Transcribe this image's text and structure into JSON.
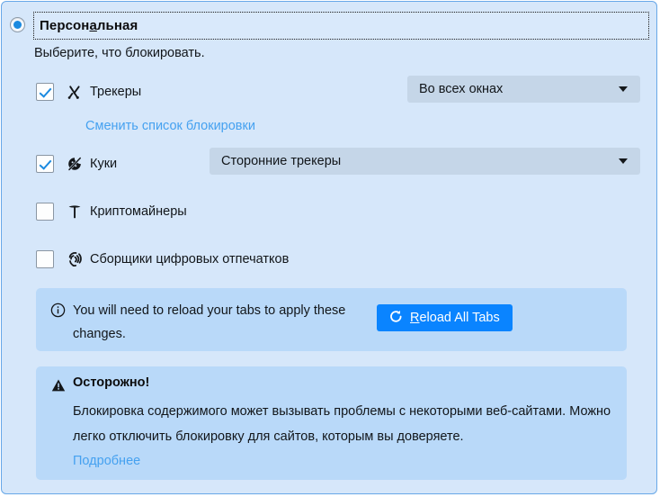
{
  "panel": {
    "mode_title": "Персональная",
    "mode_accesskey": "а",
    "subtitle": "Выберите, что блокировать."
  },
  "options": [
    {
      "id": "trackers",
      "label": "Трекеры",
      "checked": true,
      "icon": "tracker-blocked-icon",
      "dropdown": {
        "value": "Во всех окнах",
        "name": "trackers-scope-dropdown"
      },
      "link": {
        "label": "Сменить список блокировки",
        "name": "change-block-list-link"
      }
    },
    {
      "id": "cookies",
      "label": "Куки",
      "checked": true,
      "icon": "cookie-blocked-icon",
      "dropdown": {
        "value": "Сторонние трекеры",
        "name": "cookies-scope-dropdown"
      }
    },
    {
      "id": "cryptominers",
      "label": "Криптомайнеры",
      "checked": false,
      "icon": "pickaxe-icon"
    },
    {
      "id": "fingerprinters",
      "label": "Сборщики цифровых отпечатков",
      "checked": false,
      "icon": "fingerprint-icon"
    }
  ],
  "reload_notice": {
    "icon": "info-circle-icon",
    "text": "You will need to reload your tabs to apply these changes.",
    "button_label_prefix": "R",
    "button_label_rest": "eload All Tabs",
    "button_icon": "reload-icon"
  },
  "warning": {
    "icon": "warning-triangle-icon",
    "title": "Осторожно!",
    "body": "Блокировка содержимого может вызывать проблемы с некоторыми веб-сайтами. Можно легко отключить блокировку для сайтов, которым вы доверяете.",
    "link": "Подробнее"
  },
  "colors": {
    "panel_bg": "#d6e7fa",
    "panel_border": "#68a8e8",
    "infobox_bg": "#b9d9f9",
    "dropdown_bg": "#c5d6e8",
    "accent": "#0a84ff",
    "link": "#45a1f0",
    "check": "#1b8ae0"
  }
}
